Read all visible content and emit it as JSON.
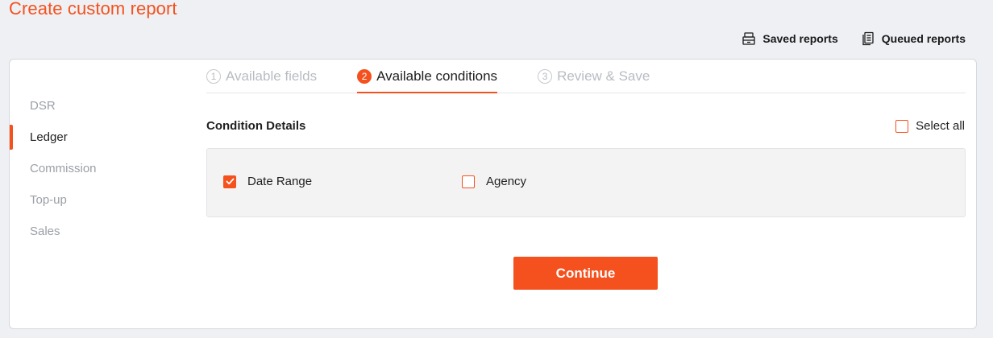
{
  "page": {
    "title": "Create custom report"
  },
  "top_actions": {
    "saved_reports": "Saved reports",
    "queued_reports": "Queued reports"
  },
  "sidebar": {
    "items": [
      {
        "label": "DSR",
        "active": false
      },
      {
        "label": "Ledger",
        "active": true
      },
      {
        "label": "Commission",
        "active": false
      },
      {
        "label": "Top-up",
        "active": false
      },
      {
        "label": "Sales",
        "active": false
      }
    ]
  },
  "steps": [
    {
      "number": "1",
      "label": "Available fields",
      "active": false
    },
    {
      "number": "2",
      "label": "Available conditions",
      "active": true
    },
    {
      "number": "3",
      "label": "Review & Save",
      "active": false
    }
  ],
  "conditions": {
    "section_title": "Condition Details",
    "select_all_label": "Select all",
    "select_all_checked": false,
    "items": [
      {
        "label": "Date Range",
        "checked": true
      },
      {
        "label": "Agency",
        "checked": false
      }
    ]
  },
  "actions": {
    "continue_label": "Continue"
  },
  "colors": {
    "accent": "#f4511e",
    "background": "#eef0f4",
    "muted_text": "#9aa0a6"
  },
  "icons": {
    "saved_reports": "stack-icon",
    "queued_reports": "document-list-icon",
    "checkmark": "checkmark-icon"
  }
}
